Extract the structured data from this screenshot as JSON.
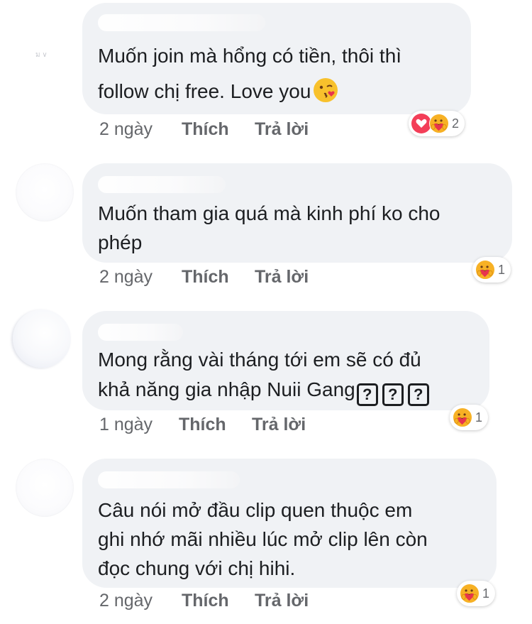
{
  "comments": [
    {
      "lines": [
        "Muốn join mà hổng có tiền, thôi thì",
        "follow chị free. Love you"
      ],
      "time": "2 ngày",
      "like": "Thích",
      "reply": "Trả lời",
      "reaction_count": "2",
      "reactions": [
        "heart-icon",
        "care-icon"
      ],
      "trailing_emoji": "kissing-heart-icon"
    },
    {
      "lines": [
        "Muốn tham gia quá mà kinh phí ko cho",
        "phép"
      ],
      "time": "2 ngày",
      "like": "Thích",
      "reply": "Trả lời",
      "reaction_count": "1",
      "reactions": [
        "care-icon"
      ]
    },
    {
      "lines": [
        "Mong rằng vài tháng tới em sẽ có đủ",
        "khả năng gia nhập Nuii Gang"
      ],
      "box_glyph": "?",
      "time": "1 ngày",
      "like": "Thích",
      "reply": "Trả lời",
      "reaction_count": "1",
      "reactions": [
        "care-icon"
      ]
    },
    {
      "lines": [
        "Câu nói mở đầu clip quen thuộc em",
        "ghi nhớ mãi nhiều lúc mở clip lên còn",
        "đọc chung với chị hihi."
      ],
      "time": "2 ngày",
      "like": "Thích",
      "reply": "Trả lời",
      "reaction_count": "1",
      "reactions": [
        "care-icon"
      ]
    }
  ],
  "avatar_mark": "ม ∨",
  "colors": {
    "bubble": "#f0f2f5",
    "text": "#1c1e21",
    "meta": "#65676b",
    "heart": "#f33e58",
    "care": "#f7b125"
  }
}
